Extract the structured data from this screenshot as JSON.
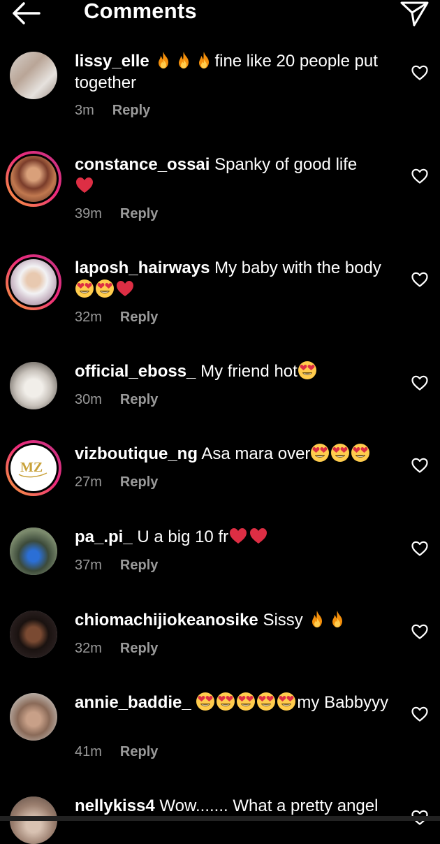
{
  "header": {
    "title": "Comments"
  },
  "comments": [
    {
      "user": "lissy_elle",
      "pre": "",
      "text": "fine like 20 people put together",
      "fire_before": 3,
      "time": "3m",
      "reply": "Reply"
    },
    {
      "user": "constance_ossai",
      "text": "Spanky of good life",
      "time": "39m",
      "reply": "Reply"
    },
    {
      "user": "laposh_hairways",
      "text": "My baby with the body",
      "time": "32m",
      "reply": "Reply"
    },
    {
      "user": "official_eboss_",
      "text": "My friend hot",
      "time": "30m",
      "reply": "Reply"
    },
    {
      "user": "vizboutique_ng",
      "text": "Asa mara over",
      "time": "27m",
      "reply": "Reply"
    },
    {
      "user": "pa_.pi_",
      "text": "U a big 10 fr",
      "time": "37m",
      "reply": "Reply"
    },
    {
      "user": "chiomachijiokeanosike",
      "text": "Sissy",
      "time": "32m",
      "reply": "Reply"
    },
    {
      "user": "annie_baddie_",
      "text": "my Babbyyy",
      "time": "41m",
      "reply": "Reply"
    },
    {
      "user": "nellykiss4",
      "text": "Wow....... What a pretty angel",
      "time": "",
      "reply": ""
    }
  ],
  "colors": {
    "background": "#000000",
    "meta": "#9a9a9a",
    "ring_start": "#f9a43a",
    "ring_end": "#c13584"
  }
}
